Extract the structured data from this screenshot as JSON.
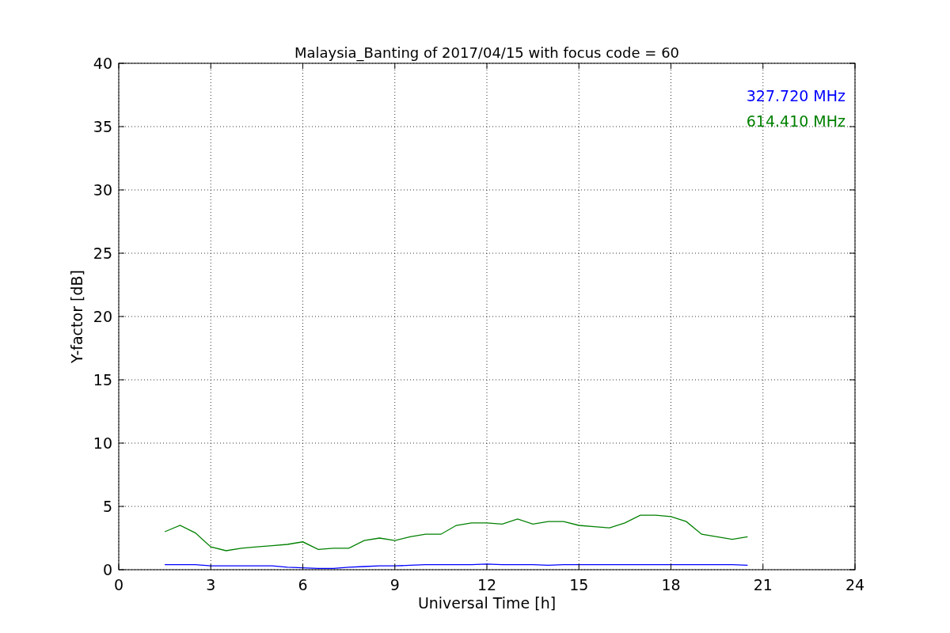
{
  "figure": {
    "chart_data": {
      "type": "line",
      "title": "Malaysia_Banting of 2017/04/15 with focus code = 60",
      "xlabel": "Universal Time [h]",
      "ylabel": "Y-factor [dB]",
      "x": [
        1.5,
        2,
        2.5,
        3,
        3.5,
        4,
        4.5,
        5,
        5.5,
        6,
        6.5,
        7,
        7.5,
        8,
        8.5,
        9,
        9.5,
        10,
        10.5,
        11,
        11.5,
        12,
        12.5,
        13,
        13.5,
        14,
        14.5,
        15,
        15.5,
        16,
        16.5,
        17,
        17.5,
        18,
        18.5,
        19,
        19.5,
        20,
        20.5
      ],
      "series": [
        {
          "name": "327.720 MHz",
          "color": "#0000ff",
          "values": [
            0.4,
            0.4,
            0.4,
            0.3,
            0.3,
            0.3,
            0.3,
            0.3,
            0.2,
            0.15,
            0.1,
            0.1,
            0.2,
            0.25,
            0.3,
            0.3,
            0.35,
            0.4,
            0.4,
            0.4,
            0.4,
            0.45,
            0.4,
            0.4,
            0.4,
            0.35,
            0.4,
            0.4,
            0.4,
            0.4,
            0.4,
            0.4,
            0.4,
            0.4,
            0.4,
            0.4,
            0.4,
            0.4,
            0.35
          ]
        },
        {
          "name": "614.410 MHz",
          "color": "#008000",
          "values": [
            3.0,
            3.5,
            2.9,
            1.8,
            1.5,
            1.7,
            1.8,
            1.9,
            2.0,
            2.2,
            1.6,
            1.7,
            1.7,
            2.3,
            2.5,
            2.3,
            2.6,
            2.8,
            2.8,
            3.5,
            3.7,
            3.7,
            3.6,
            4.0,
            3.6,
            3.8,
            3.8,
            3.5,
            3.4,
            3.3,
            3.7,
            4.3,
            4.3,
            4.2,
            3.8,
            2.8,
            2.6,
            2.4,
            2.6
          ]
        }
      ],
      "xlim": [
        0,
        24
      ],
      "ylim": [
        0,
        40
      ],
      "xticks": [
        0,
        3,
        6,
        9,
        12,
        15,
        18,
        21,
        24
      ],
      "yticks": [
        0,
        5,
        10,
        15,
        20,
        25,
        30,
        35,
        40
      ],
      "grid": true
    }
  }
}
